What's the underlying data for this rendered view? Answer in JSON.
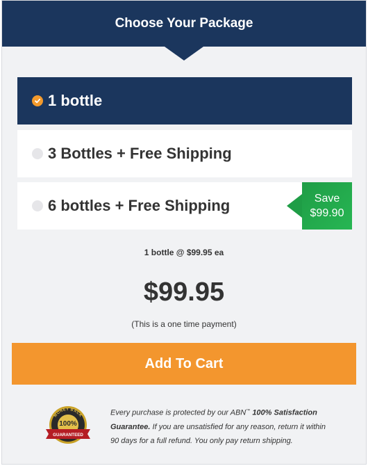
{
  "header": {
    "title": "Choose Your Package"
  },
  "options": [
    {
      "label": "1 bottle",
      "selected": true
    },
    {
      "label": "3 Bottles + Free Shipping",
      "selected": false
    },
    {
      "label": "6 bottles + Free Shipping",
      "selected": false
    }
  ],
  "save_badge": {
    "line1": "Save",
    "line2": "$99.90"
  },
  "summary": {
    "per_bottle": "1 bottle @ $99.95 ea",
    "price": "$99.95",
    "payment_note": "(This is a one time payment)"
  },
  "cta": {
    "label": "Add To Cart"
  },
  "guarantee": {
    "seal_top": "MONEY BACK",
    "seal_percent": "100%",
    "seal_banner": "GUARANTEED",
    "text_prefix": "Every purchase is protected by our ABN",
    "text_tm": "™",
    "text_bold": "100% Satisfaction Guarantee.",
    "text_rest": " If you are unsatisfied for any reason, return it within 90 days for a full refund. You only pay return shipping."
  },
  "colors": {
    "navy": "#1b365d",
    "orange": "#f3962e",
    "green": "#27b653",
    "background": "#f1f2f4"
  }
}
